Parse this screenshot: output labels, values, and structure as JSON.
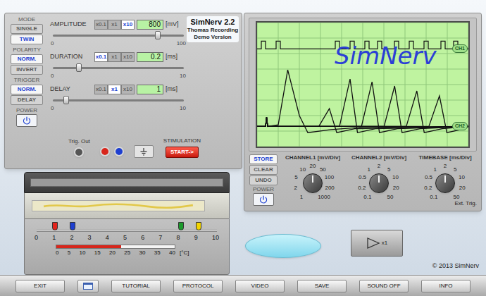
{
  "title": {
    "name": "SimNerv 2.2",
    "subtitle": "Thomas Recording",
    "edition": "Demo Version"
  },
  "stimulator": {
    "groups": [
      {
        "label": "MODE",
        "options": [
          {
            "label": "SINGLE",
            "selected": false
          },
          {
            "label": "TWIN",
            "selected": true
          }
        ]
      },
      {
        "label": "POLARITY",
        "options": [
          {
            "label": "NORM.",
            "selected": true
          },
          {
            "label": "INVERT",
            "selected": false
          }
        ]
      },
      {
        "label": "TRIGGER",
        "options": [
          {
            "label": "NORM.",
            "selected": true
          },
          {
            "label": "DELAY",
            "selected": false
          }
        ]
      }
    ],
    "power": {
      "label": "POWER"
    },
    "sliders": [
      {
        "label": "AMPLITUDE",
        "multipliers": [
          {
            "label": "x0.1",
            "selected": false
          },
          {
            "label": "x1",
            "selected": false
          },
          {
            "label": "x10",
            "selected": true
          }
        ],
        "value": "800",
        "unit": "[mV]",
        "min": "0",
        "max": "100",
        "level": 0.8
      },
      {
        "label": "DURATION",
        "multipliers": [
          {
            "label": "x0.1",
            "selected": true
          },
          {
            "label": "x1",
            "selected": false
          },
          {
            "label": "x10",
            "selected": false
          }
        ],
        "value": "0.2",
        "unit": "[ms]",
        "min": "0",
        "max": "10",
        "level": 0.2
      },
      {
        "label": "DELAY",
        "multipliers": [
          {
            "label": "x0.1",
            "selected": false
          },
          {
            "label": "x1",
            "selected": true
          },
          {
            "label": "x10",
            "selected": false
          }
        ],
        "value": "1",
        "unit": "[ms]",
        "min": "0",
        "max": "10",
        "level": 0.1
      }
    ],
    "trig_out": "Trig. Out",
    "stimulation": "STIMULATION",
    "start_button": "START->"
  },
  "oscilloscope": {
    "screen": {
      "watermark": "SimNerv",
      "ch1_label": "CH1",
      "ch2_label": "CH2",
      "ch1_baseline": 6.3,
      "ch2_baseline": 1.3,
      "ch1_pulses": [
        0.2,
        0.9,
        3.7,
        4.4,
        5.1,
        5.7,
        6.5,
        7.2,
        7.9,
        8.7,
        9.3
      ],
      "ch2_traces": [
        {
          "points": [
            [
              0,
              1.3
            ],
            [
              0.4,
              1.3
            ],
            [
              0.45,
              1.9
            ],
            [
              0.5,
              1.3
            ],
            [
              1.0,
              1.4
            ],
            [
              1.45,
              4.95
            ],
            [
              2.0,
              2.0
            ],
            [
              2.4,
              0.9
            ],
            [
              3.5,
              1.1
            ],
            [
              5,
              1.25
            ],
            [
              10,
              1.3
            ]
          ]
        },
        {
          "points": [
            [
              0,
              1.3
            ],
            [
              0.4,
              1.3
            ],
            [
              0.45,
              1.9
            ],
            [
              0.5,
              1.3
            ],
            [
              2.92,
              1.3
            ],
            [
              3.42,
              2.45
            ],
            [
              3.77,
              0.9
            ],
            [
              4.62,
              1.15
            ],
            [
              10,
              1.3
            ]
          ]
        },
        {
          "points": [
            [
              0,
              1.3
            ],
            [
              0.4,
              1.3
            ],
            [
              0.45,
              1.9
            ],
            [
              0.5,
              1.3
            ],
            [
              3.9,
              1.3
            ],
            [
              4.4,
              4.36
            ],
            [
              4.75,
              0.9
            ],
            [
              5.6,
              1.15
            ],
            [
              10,
              1.3
            ]
          ]
        },
        {
          "points": [
            [
              0,
              1.3
            ],
            [
              0.4,
              1.3
            ],
            [
              0.45,
              1.9
            ],
            [
              0.5,
              1.3
            ],
            [
              4.94,
              1.3
            ],
            [
              5.44,
              4.18
            ],
            [
              5.79,
              0.9
            ],
            [
              6.64,
              1.15
            ],
            [
              10,
              1.3
            ]
          ]
        },
        {
          "points": [
            [
              0,
              1.3
            ],
            [
              0.4,
              1.3
            ],
            [
              0.45,
              1.9
            ],
            [
              0.5,
              1.3
            ],
            [
              6.01,
              1.3
            ],
            [
              6.51,
              3.91
            ],
            [
              6.86,
              0.9
            ],
            [
              7.71,
              1.15
            ],
            [
              10,
              1.3
            ]
          ]
        },
        {
          "points": [
            [
              0,
              1.3
            ],
            [
              0.4,
              1.3
            ],
            [
              0.45,
              1.9
            ],
            [
              0.5,
              1.3
            ],
            [
              7.06,
              1.3
            ],
            [
              7.56,
              3.59
            ],
            [
              7.91,
              0.9
            ],
            [
              8.76,
              1.15
            ],
            [
              10,
              1.3
            ]
          ]
        },
        {
          "points": [
            [
              0,
              1.3
            ],
            [
              0.4,
              1.3
            ],
            [
              0.45,
              1.9
            ],
            [
              0.5,
              1.3
            ],
            [
              8.13,
              1.3
            ],
            [
              8.63,
              3.27
            ],
            [
              8.98,
              0.9
            ],
            [
              9.83,
              1.15
            ],
            [
              10,
              1.3
            ]
          ]
        }
      ]
    },
    "memory_buttons": [
      {
        "label": "STORE",
        "selected": true
      },
      {
        "label": "CLEAR",
        "selected": false
      },
      {
        "label": "UNDO",
        "selected": false
      }
    ],
    "power": {
      "label": "POWER"
    },
    "dials": [
      {
        "label": "CHANNEL1 [mV/Div]",
        "ticks": [
          {
            "label": "1",
            "selected": false
          },
          {
            "label": "2",
            "selected": false
          },
          {
            "label": "5",
            "selected": false
          },
          {
            "label": "10",
            "selected": false
          },
          {
            "label": "20",
            "selected": true
          },
          {
            "label": "50",
            "selected": false
          },
          {
            "label": "100",
            "selected": false
          },
          {
            "label": "200",
            "selected": false
          },
          {
            "label": "1000",
            "selected": false
          }
        ]
      },
      {
        "label": "CHANNEL2 [mV/Div]",
        "ticks": [
          {
            "label": "0.1",
            "selected": false
          },
          {
            "label": "0.2",
            "selected": false
          },
          {
            "label": "0.5",
            "selected": false
          },
          {
            "label": "1",
            "selected": false
          },
          {
            "label": "2",
            "selected": true
          },
          {
            "label": "5",
            "selected": false
          },
          {
            "label": "10",
            "selected": false
          },
          {
            "label": "20",
            "selected": false
          },
          {
            "label": "50",
            "selected": false
          }
        ]
      },
      {
        "label": "TIMEBASE [ms/Div]",
        "ticks": [
          {
            "label": "0.1",
            "selected": false
          },
          {
            "label": "0.2",
            "selected": false
          },
          {
            "label": "0.5",
            "selected": false
          },
          {
            "label": "1",
            "selected": false
          },
          {
            "label": "2",
            "selected": true
          },
          {
            "label": "5",
            "selected": false
          },
          {
            "label": "10",
            "selected": false
          },
          {
            "label": "20",
            "selected": false
          },
          {
            "label": "50",
            "selected": false
          }
        ],
        "note": "Ext. Trig."
      }
    ]
  },
  "chamber": {
    "electrodes": [
      {
        "color": "#e3231b",
        "position": 1
      },
      {
        "color": "#1e3fd0",
        "position": 2
      },
      {
        "color": "#1c9a2c",
        "position": 8
      },
      {
        "color": "#f2d400",
        "position": 9
      }
    ],
    "scale": [
      "0",
      "1",
      "2",
      "3",
      "4",
      "5",
      "6",
      "7",
      "8",
      "9",
      "10"
    ],
    "thermometer": {
      "ticks": [
        "0",
        "5",
        "10",
        "15",
        "20",
        "25",
        "30",
        "35",
        "40"
      ],
      "unit": "[°C]",
      "level": 0.55
    }
  },
  "amplifier": {
    "label": "x1"
  },
  "copyright": "© 2013 SimNerv",
  "bottom_bar": [
    {
      "kind": "text",
      "label": "EXIT"
    },
    {
      "kind": "icon"
    },
    {
      "kind": "text",
      "label": "TUTORIAL"
    },
    {
      "kind": "text",
      "label": "PROTOCOL"
    },
    {
      "kind": "text",
      "label": "VIDEO"
    },
    {
      "kind": "text",
      "label": "SAVE"
    },
    {
      "kind": "text",
      "label": "SOUND OFF"
    },
    {
      "kind": "text",
      "label": "INFO"
    }
  ]
}
